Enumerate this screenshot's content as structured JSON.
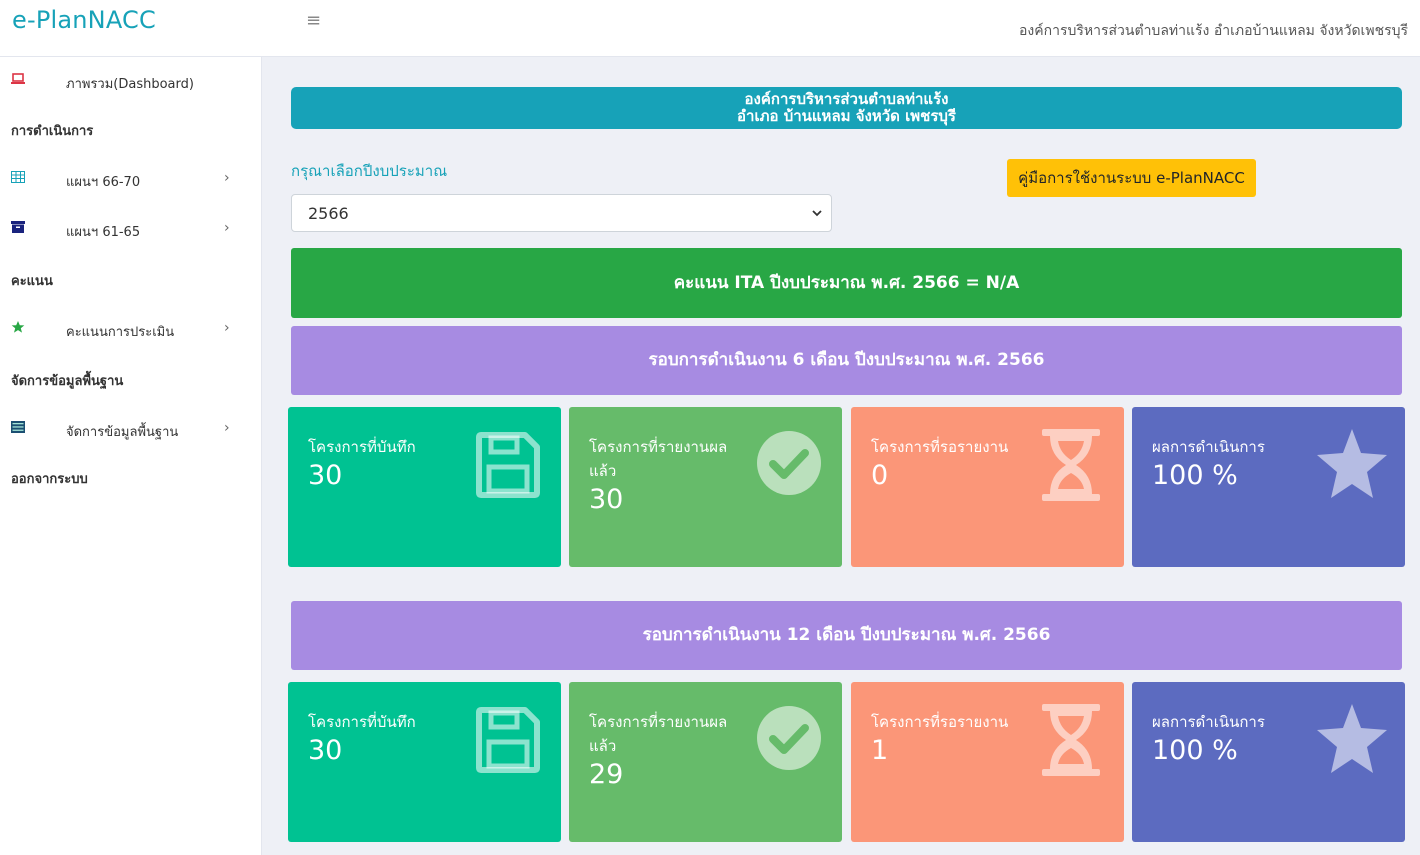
{
  "header": {
    "brand": "e-PlanNACC",
    "hamburger": "≡",
    "org_name": "องค์การบริหารส่วนตำบลท่าแร้ง อำเภอบ้านแหลม จังหวัดเพชรบุรี"
  },
  "sidebar": {
    "dashboard": {
      "label": "ภาพรวม(Dashboard)",
      "icon": "laptop-icon"
    },
    "section_operations": "การดำเนินการ",
    "plan_66_70": {
      "label": "แผนฯ 66-70",
      "icon": "table-icon"
    },
    "plan_61_65": {
      "label": "แผนฯ 61-65",
      "icon": "archive-icon"
    },
    "section_scores": "คะแนน",
    "evaluation": {
      "label": "คะแนนการประเมิน",
      "icon": "star-icon"
    },
    "section_basedata": "จัดการข้อมูลพื้นฐาน",
    "basedata": {
      "label": "จัดการข้อมูลพื้นฐาน",
      "icon": "list-icon"
    },
    "logout": "ออกจากระบบ",
    "chevron": "›"
  },
  "main": {
    "banner_line1": "องค์การบริหารส่วนตำบลท่าแร้ง",
    "banner_line2": "อำเภอ บ้านแหลม จังหวัด เพชรบุรี",
    "year_label": "กรุณาเลือกปีงบประมาณ",
    "year_selected": "2566",
    "manual_button": "คู่มือการใช้งานระบบ e-PlanNACC",
    "ita_text": "คะแนน ITA ปีงบประมาณ พ.ศ. 2566 = N/A",
    "round6": {
      "title": "รอบการดำเนินงาน 6 เดือน ปีงบประมาณ พ.ศ. 2566",
      "recorded": {
        "label": "โครงการที่บันทึก",
        "value": "30"
      },
      "reported": {
        "label": "โครงการที่รายงานผลแล้ว",
        "value": "30"
      },
      "waiting": {
        "label": "โครงการที่รอรายงาน",
        "value": "0"
      },
      "result": {
        "label": "ผลการดำเนินการ",
        "value": "100 %"
      }
    },
    "round12": {
      "title": "รอบการดำเนินงาน 12 เดือน ปีงบประมาณ พ.ศ. 2566",
      "recorded": {
        "label": "โครงการที่บันทึก",
        "value": "30"
      },
      "reported": {
        "label": "โครงการที่รายงานผลแล้ว",
        "value": "29"
      },
      "waiting": {
        "label": "โครงการที่รอรายงาน",
        "value": "1"
      },
      "result": {
        "label": "ผลการดำเนินการ",
        "value": "100 %"
      }
    }
  },
  "colors": {
    "brand": "#17a2b8",
    "ita": "#28a745",
    "round": "#a78be2",
    "card_recorded": "#00c292",
    "card_reported": "#66bb6a",
    "card_waiting": "#fb9678",
    "card_result": "#5c6bc0",
    "manual_button": "#ffc107"
  }
}
